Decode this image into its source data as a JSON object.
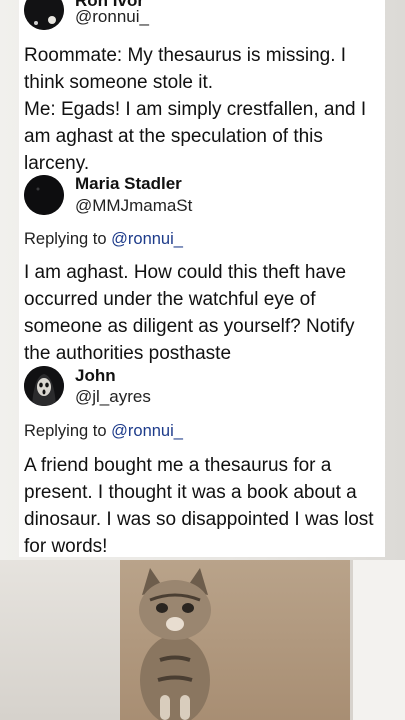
{
  "tweets": [
    {
      "display_name": "Ron Ivor",
      "handle": "@ronnui_",
      "text": "Roommate: My thesaurus is missing. I think someone stole it.\nMe: Egads! I am simply crestfallen, and I am aghast at the speculation of this larceny."
    },
    {
      "display_name": "Maria Stadler",
      "handle": "@MMJmamaSt",
      "reply_prefix": "Replying to",
      "reply_to": "@ronnui_",
      "text": "I am aghast.  How could this theft  have occurred under the watchful eye of someone as diligent as yourself?  Notify the authorities posthaste"
    },
    {
      "display_name": "John",
      "handle": "@jl_ayres",
      "reply_prefix": "Replying to",
      "reply_to": "@ronnui_",
      "text": "A friend bought me a thesaurus for a present. I thought it was a book about a dinosaur. I was so disappointed I was lost for words!"
    }
  ],
  "icons": {
    "avatar_1": "avatar-icon",
    "avatar_2": "avatar-icon",
    "avatar_3": "hooded-figure-avatar-icon"
  },
  "colors": {
    "card": "#ffffff",
    "mention": "#1d3b8a",
    "text": "#111111"
  }
}
